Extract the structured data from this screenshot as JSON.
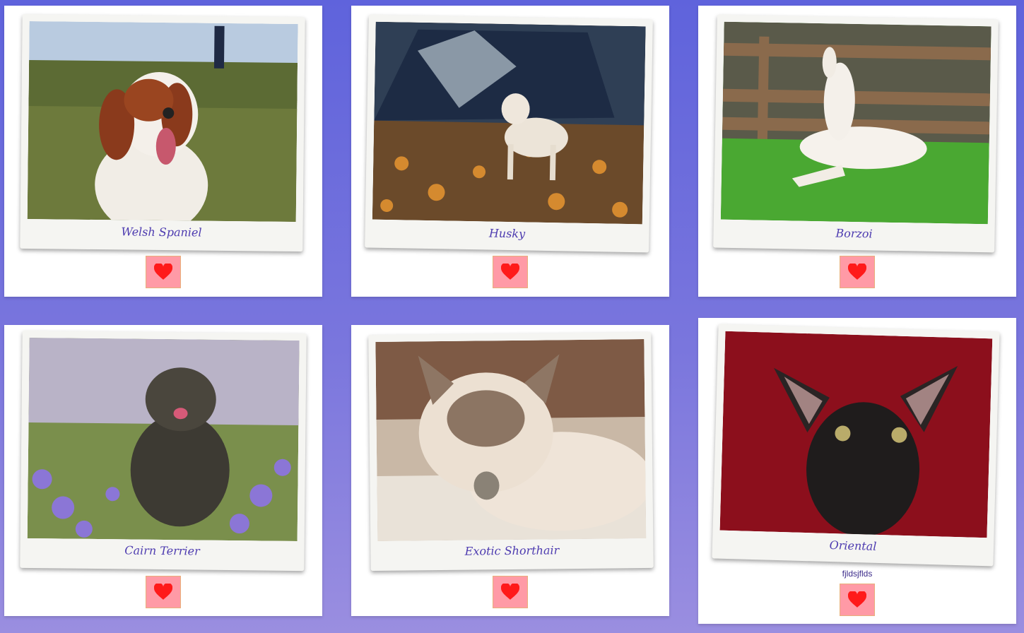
{
  "cards": [
    {
      "caption": "Welsh Spaniel",
      "like_icon": "heart-icon",
      "like_color": "#ff1a1a"
    },
    {
      "caption": "Husky",
      "like_icon": "heart-icon",
      "like_color": "#ff1a1a"
    },
    {
      "caption": "Borzoi",
      "like_icon": "heart-icon",
      "like_color": "#ff1a1a"
    },
    {
      "caption": "Cairn Terrier",
      "like_icon": "heart-icon",
      "like_color": "#ff1a1a"
    },
    {
      "caption": "Exotic Shorthair",
      "like_icon": "heart-icon",
      "like_color": "#ff1a1a"
    },
    {
      "caption": "Oriental",
      "note": "fjldsjflds",
      "like_icon": "heart-icon",
      "like_color": "#ff1a1a"
    }
  ],
  "colors": {
    "accent": "#4d3bb0",
    "button_bg": "#ff9aa6",
    "heart": "#ff1a1a"
  }
}
